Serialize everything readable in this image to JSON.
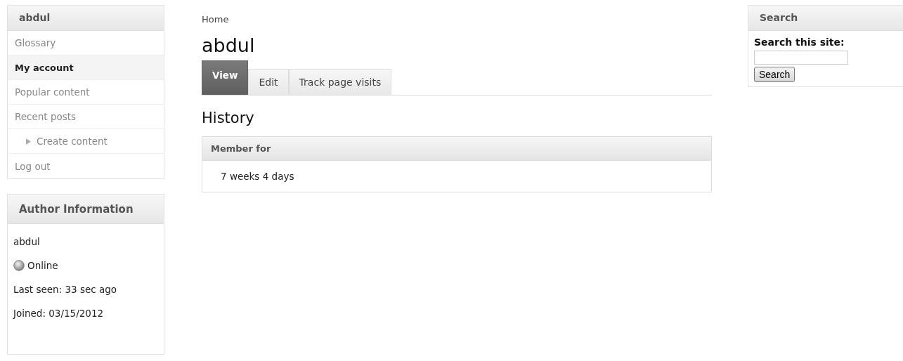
{
  "user_menu": {
    "title": "abdul",
    "items": [
      {
        "label": "Glossary",
        "selected": false,
        "kind": "link"
      },
      {
        "label": "My account",
        "selected": true,
        "kind": "link"
      },
      {
        "label": "Popular content",
        "selected": false,
        "kind": "link"
      },
      {
        "label": "Recent posts",
        "selected": false,
        "kind": "link"
      },
      {
        "label": "Create content",
        "selected": false,
        "kind": "collapsed"
      },
      {
        "label": "Log out",
        "selected": false,
        "kind": "link"
      }
    ]
  },
  "author_info": {
    "title": "Author Information",
    "name": "abdul",
    "status": "Online",
    "last_seen": "Last seen: 33 sec ago",
    "joined": "Joined: 03/15/2012"
  },
  "breadcrumb": "Home",
  "page_title": "abdul",
  "tabs": [
    {
      "label": "View",
      "selected": true
    },
    {
      "label": "Edit",
      "selected": false
    },
    {
      "label": "Track page visits",
      "selected": false
    }
  ],
  "section_title": "History",
  "history": {
    "heading": "Member for",
    "value": "7 weeks 4 days"
  },
  "search": {
    "title": "Search",
    "label": "Search this site:",
    "button": "Search"
  }
}
